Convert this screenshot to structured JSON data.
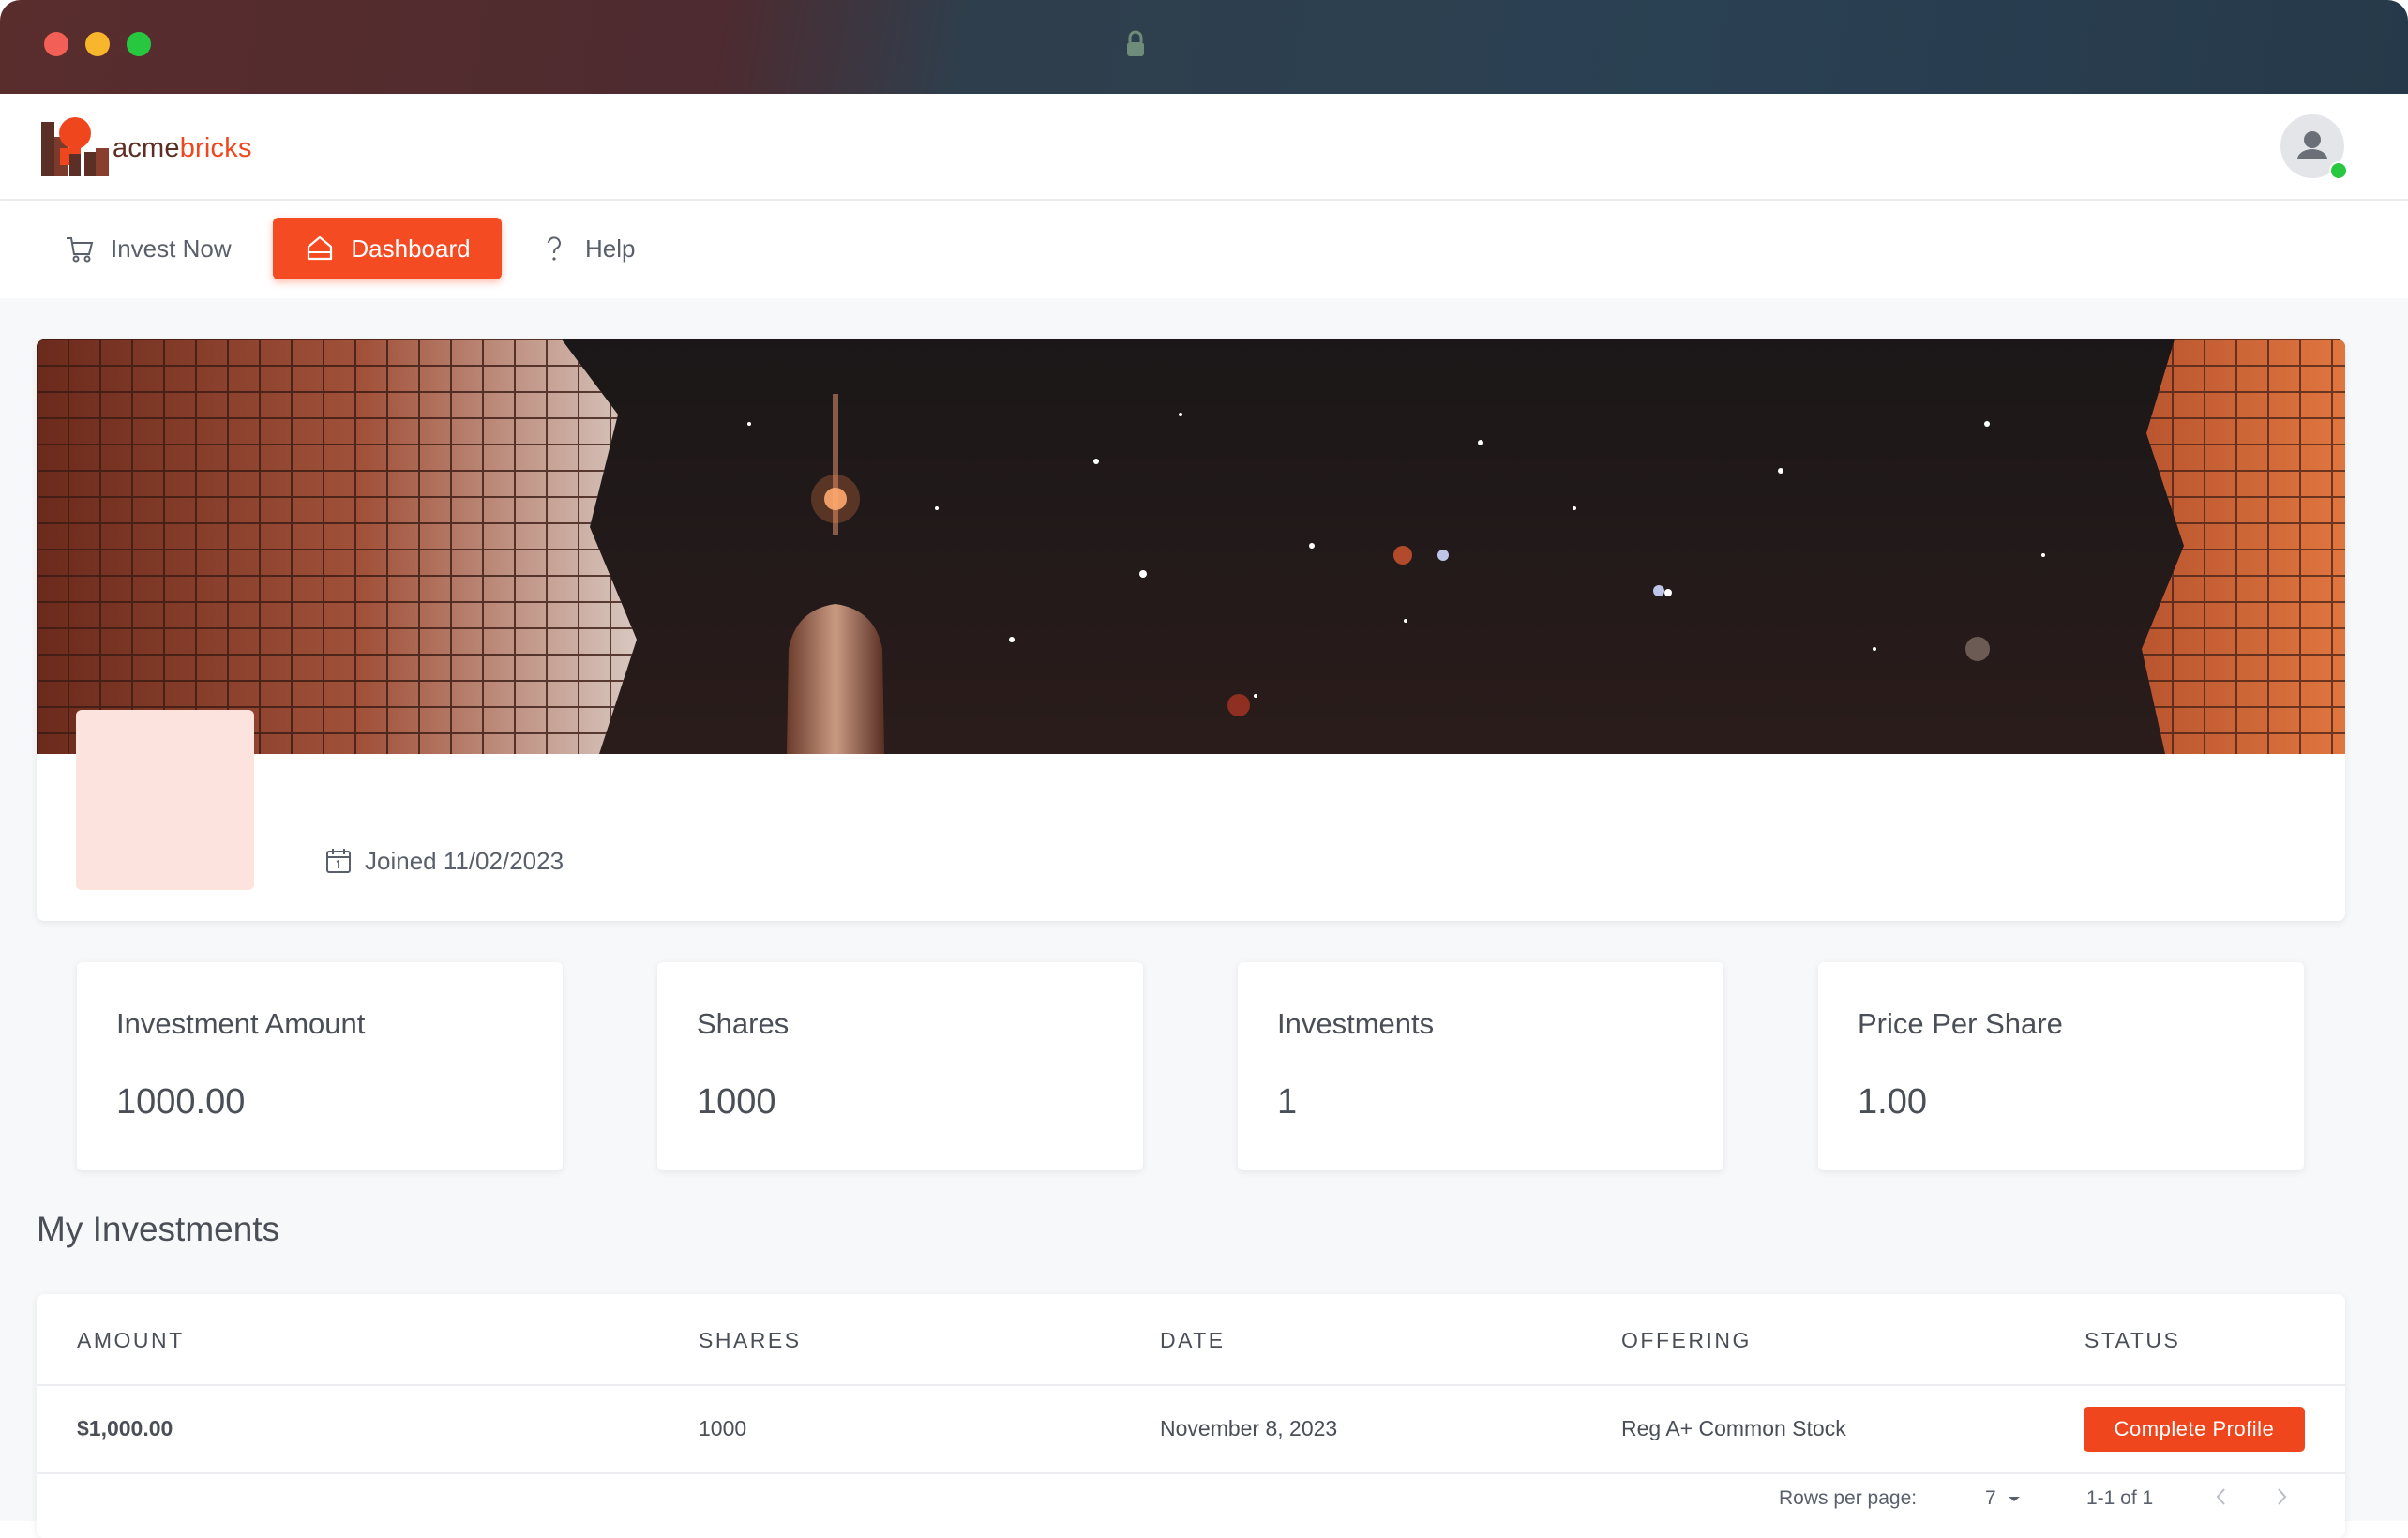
{
  "brand": {
    "name_part1": "acme",
    "name_part2": "bricks",
    "primary_color": "#f54b23",
    "dark_color": "#5b2f26"
  },
  "nav": {
    "items": [
      {
        "label": "Invest Now",
        "icon": "cart-icon"
      },
      {
        "label": "Dashboard",
        "icon": "home-icon",
        "active": true
      },
      {
        "label": "Help",
        "icon": "question-icon"
      }
    ]
  },
  "profile": {
    "joined": "Joined 11/02/2023"
  },
  "stats": [
    {
      "label": "Investment Amount",
      "value": "1000.00"
    },
    {
      "label": "Shares",
      "value": "1000"
    },
    {
      "label": "Investments",
      "value": "1"
    },
    {
      "label": "Price Per Share",
      "value": "1.00"
    }
  ],
  "investments": {
    "title": "My Investments",
    "columns": [
      "AMOUNT",
      "SHARES",
      "DATE",
      "OFFERING",
      "STATUS"
    ],
    "rows": [
      {
        "amount": "$1,000.00",
        "shares": "1000",
        "date": "November 8, 2023",
        "offering": "Reg A+ Common Stock",
        "status": "Complete Profile"
      }
    ],
    "pagination": {
      "rows_per_page_label": "Rows per page:",
      "rows_per_page_value": "7",
      "range": "1-1 of 1"
    }
  }
}
